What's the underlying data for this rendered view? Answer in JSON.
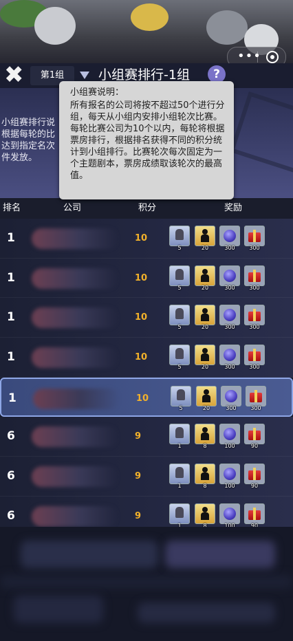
{
  "header": {
    "close_label": "✖",
    "group_button": "第1组",
    "title": "小组赛排行-1组",
    "help_label": "?"
  },
  "capsule": {
    "more_label": "•••"
  },
  "info_behind": "小组赛排行说\n根据每轮的比\n达到指定名次\n件发放。",
  "tooltip": {
    "title": "小组赛说明：",
    "body": "所有报名的公司将按不超过50个进行分组，每天从小组内安排小组轮次比赛。每轮比赛公司为10个以内，每轮将根据票房排行，根据排名获得不同的积分统计到小组排行。比赛轮次每次固定为一个主题剧本，票房成绩取该轮次的最高值。"
  },
  "table_header": {
    "rank": "排名",
    "company": "公司",
    "score": "积分",
    "reward": "奖励"
  },
  "rows": [
    {
      "rank": "1",
      "score": "10",
      "card": "5",
      "figure": "20",
      "gem": "300",
      "gift": "300"
    },
    {
      "rank": "1",
      "score": "10",
      "card": "5",
      "figure": "20",
      "gem": "300",
      "gift": "300"
    },
    {
      "rank": "1",
      "score": "10",
      "card": "5",
      "figure": "20",
      "gem": "300",
      "gift": "300"
    },
    {
      "rank": "1",
      "score": "10",
      "card": "5",
      "figure": "20",
      "gem": "300",
      "gift": "300"
    },
    {
      "rank": "1",
      "score": "10",
      "card": "5",
      "figure": "20",
      "gem": "300",
      "gift": "300",
      "highlight": true
    },
    {
      "rank": "6",
      "score": "9",
      "card": "1",
      "figure": "8",
      "gem": "100",
      "gift": "90"
    },
    {
      "rank": "6",
      "score": "9",
      "card": "1",
      "figure": "8",
      "gem": "100",
      "gift": "90"
    },
    {
      "rank": "6",
      "score": "9",
      "card": "1",
      "figure": "8",
      "gem": "100",
      "gift": "90"
    }
  ],
  "colors": {
    "score": "#f2b12a",
    "highlight_border": "#8ea6e6",
    "help_button": "#7a73c8"
  }
}
